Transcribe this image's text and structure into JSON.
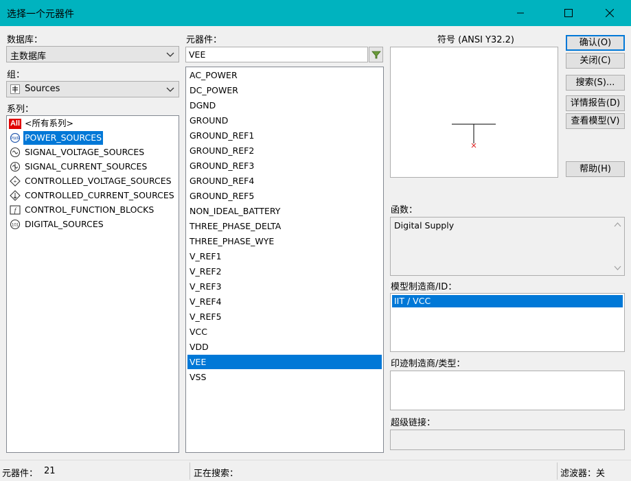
{
  "window": {
    "title": "选择一个元器件"
  },
  "left": {
    "database_label": "数据库：",
    "database_value": "主数据库",
    "group_label": "组：",
    "group_value": "Sources",
    "family_label": "系列：",
    "families": [
      {
        "label": "<所有系列>",
        "icon": "all-icon"
      },
      {
        "label": "POWER_SOURCES",
        "icon": "power-source-icon"
      },
      {
        "label": "SIGNAL_VOLTAGE_SOURCES",
        "icon": "signal-voltage-icon"
      },
      {
        "label": "SIGNAL_CURRENT_SOURCES",
        "icon": "signal-current-icon"
      },
      {
        "label": "CONTROLLED_VOLTAGE_SOURCES",
        "icon": "controlled-voltage-icon"
      },
      {
        "label": "CONTROLLED_CURRENT_SOURCES",
        "icon": "controlled-current-icon"
      },
      {
        "label": "CONTROL_FUNCTION_BLOCKS",
        "icon": "function-block-icon"
      },
      {
        "label": "DIGITAL_SOURCES",
        "icon": "digital-source-icon"
      }
    ],
    "selected_family": 1
  },
  "middle": {
    "component_label": "元器件：",
    "component_value": "VEE",
    "components": [
      "AC_POWER",
      "DC_POWER",
      "DGND",
      "GROUND",
      "GROUND_REF1",
      "GROUND_REF2",
      "GROUND_REF3",
      "GROUND_REF4",
      "GROUND_REF5",
      "NON_IDEAL_BATTERY",
      "THREE_PHASE_DELTA",
      "THREE_PHASE_WYE",
      "V_REF1",
      "V_REF2",
      "V_REF3",
      "V_REF4",
      "V_REF5",
      "VCC",
      "VDD",
      "VEE",
      "VSS"
    ],
    "selected_component": 19
  },
  "right": {
    "symbol_label": "符号 (ANSI Y32.2)",
    "function_label": "函数：",
    "function_text": "Digital Supply",
    "model_label": "模型制造商/ID：",
    "model_items": [
      "IIT / VCC"
    ],
    "footprint_label": "印迹制造商/类型：",
    "hyperlink_label": "超级链接："
  },
  "buttons": {
    "ok": "确认(O)",
    "close": "关闭(C)",
    "search": "搜索(S)...",
    "report": "详情报告(D)",
    "view_model": "查看模型(V)",
    "help": "帮助(H)"
  },
  "status": {
    "count_label": "元器件：",
    "count_value": "21",
    "searching": "正在搜索：",
    "filter": "滤波器：关"
  },
  "colors": {
    "titlebar": "#00b3bf",
    "selection": "#0078d7",
    "symbol_marker": "#e02020"
  }
}
